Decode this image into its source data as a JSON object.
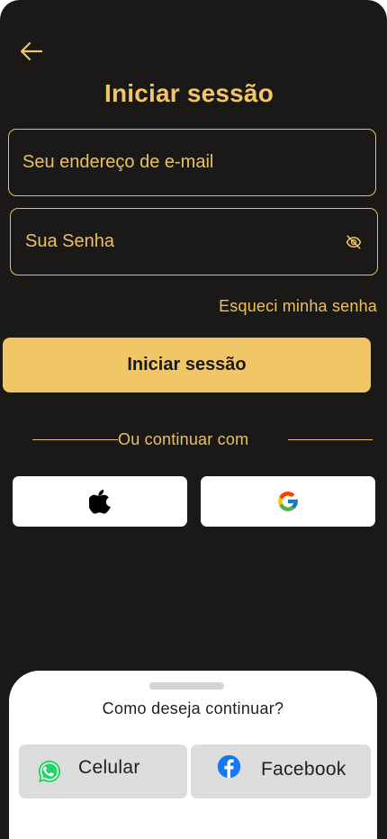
{
  "header": {
    "title": "Iniciar sessão"
  },
  "form": {
    "email_placeholder": "Seu endereço de e-mail",
    "password_placeholder": "Sua Senha",
    "forgot_password": "Esqueci minha senha",
    "submit_label": "Iniciar sessão"
  },
  "social": {
    "divider_text": "Ou continuar com"
  },
  "sheet": {
    "title": "Como deseja continuar?",
    "options": [
      {
        "label": "Celular",
        "icon": "whatsapp-icon"
      },
      {
        "label": "Facebook",
        "icon": "facebook-icon"
      }
    ]
  },
  "colors": {
    "background": "#1b1918",
    "accent": "#f0c667",
    "sheet_background": "#ffffff",
    "option_background": "#dcdcdc",
    "whatsapp": "#25d366",
    "facebook": "#1877f2"
  },
  "icons": {
    "back": "arrow-left-icon",
    "password_toggle": "eye-off-icon",
    "apple": "apple-icon",
    "google": "google-icon"
  }
}
